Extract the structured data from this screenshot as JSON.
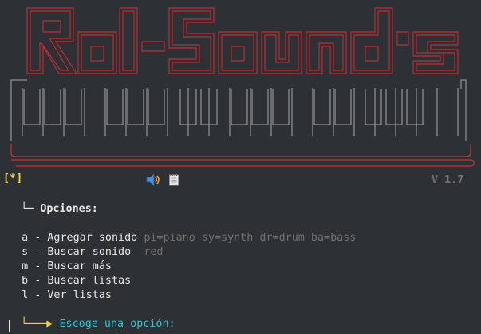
{
  "window": {
    "background": "#2d3035"
  },
  "banner": {
    "title_art_text": "Rol-Sounds",
    "title_color": "#c12c33",
    "piano_color": "#a9a9a9"
  },
  "status": {
    "marker": "[*]",
    "sound_icon": "speaker-icon",
    "notes_icon": "notepad-icon",
    "version": "V 1.7"
  },
  "options": {
    "tree_prefix": "└─",
    "heading": "Opciones:",
    "items": [
      {
        "key": "a",
        "label": "Agregar sonido",
        "hint": "pi=piano sy=synth dr=drum ba=bass"
      },
      {
        "key": "s",
        "label": "Buscar sonido",
        "hint": "red"
      },
      {
        "key": "m",
        "label": "Buscar más",
        "hint": ""
      },
      {
        "key": "b",
        "label": "Buscar listas",
        "hint": ""
      },
      {
        "key": "l",
        "label": "Ver listas",
        "hint": ""
      }
    ]
  },
  "prompt": {
    "arrow": "└───▶",
    "text": "Escoge una opción:",
    "value": ""
  }
}
